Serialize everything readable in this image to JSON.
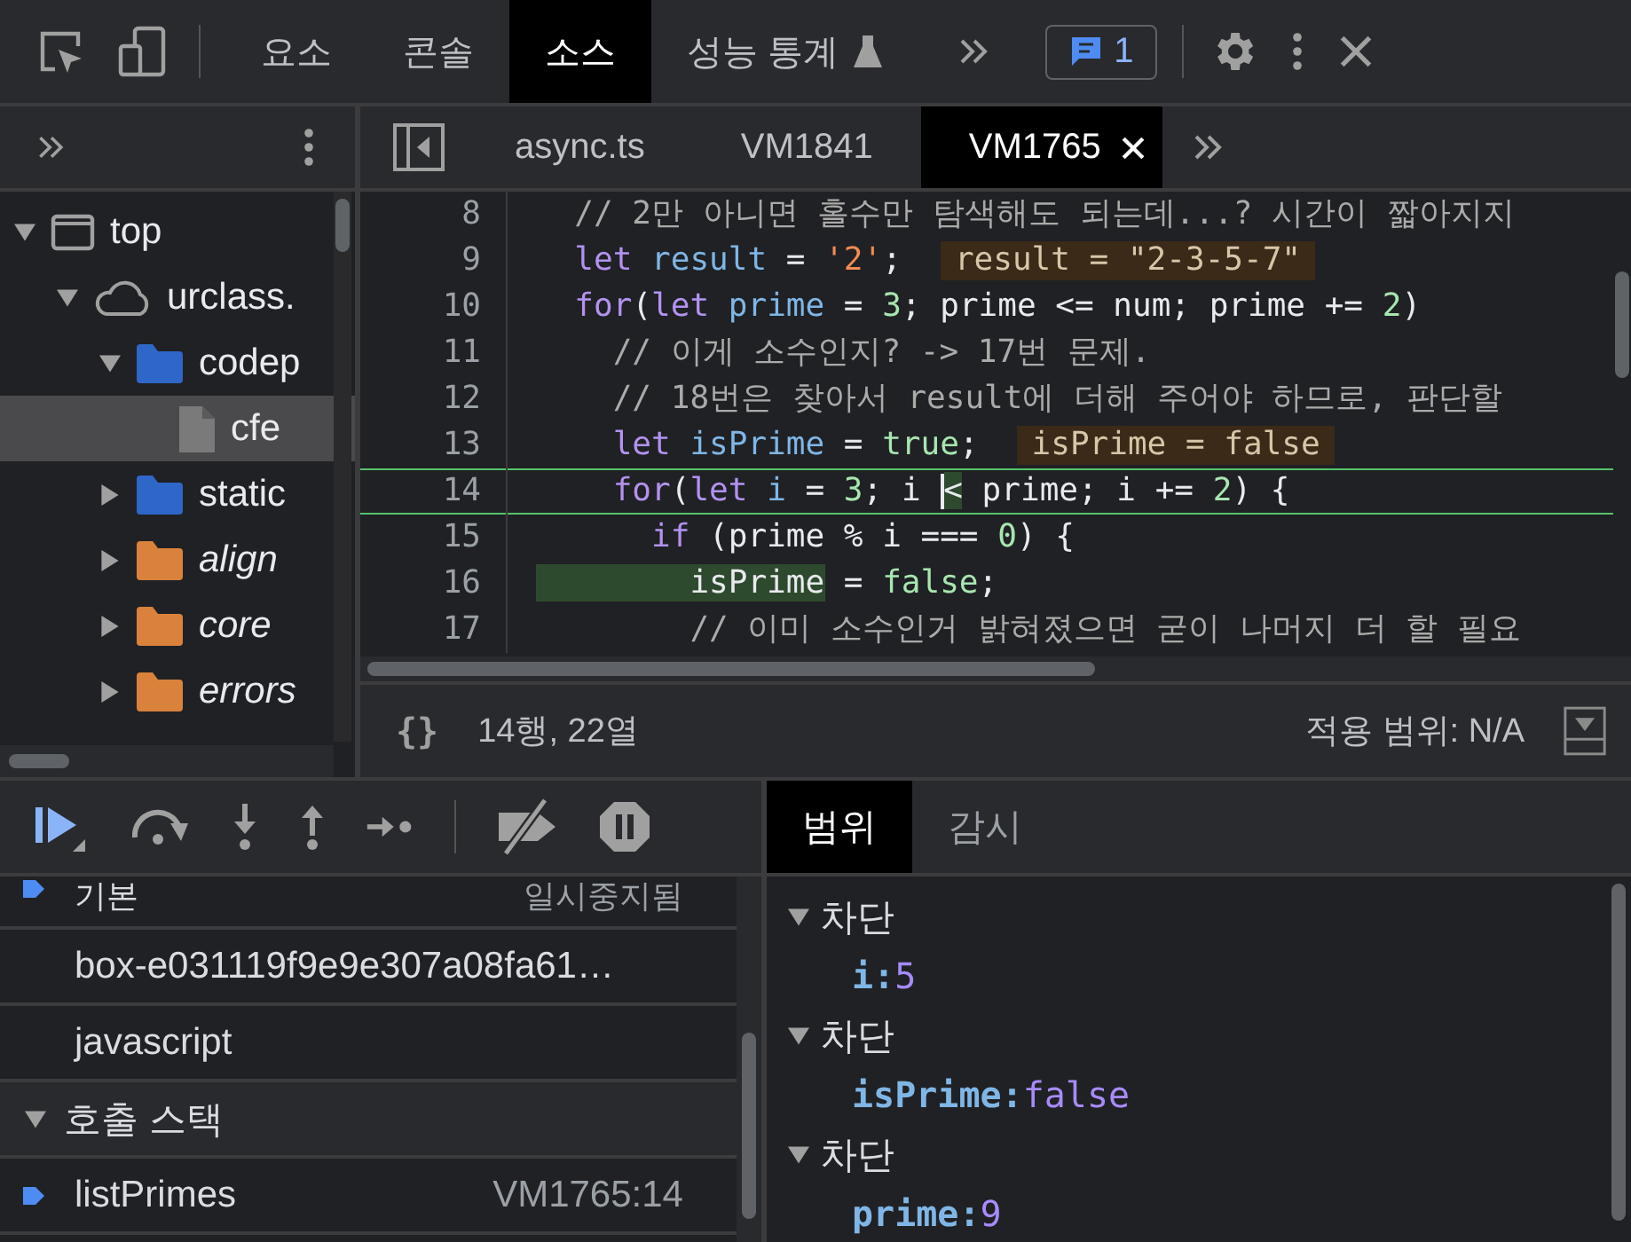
{
  "toolbar": {
    "tabs": [
      {
        "label": "요소",
        "selected": false,
        "experimental": false
      },
      {
        "label": "콘솔",
        "selected": false,
        "experimental": false
      },
      {
        "label": "소스",
        "selected": true,
        "experimental": false
      },
      {
        "label": "성능 통계",
        "selected": false,
        "experimental": true
      }
    ],
    "issues_count": "1"
  },
  "sidebar": {
    "nodes": [
      {
        "label": "top",
        "kind": "frame",
        "expanded": true,
        "selected": false,
        "children": [
          {
            "label": "urclass.",
            "kind": "domain",
            "expanded": true,
            "selected": false,
            "children": [
              {
                "label": "codep",
                "kind": "folder",
                "color": "#2f67c8",
                "ignored": false,
                "expanded": true,
                "selected": false,
                "children": [
                  {
                    "label": "cfe",
                    "kind": "file",
                    "selected": true
                  }
                ]
              },
              {
                "label": "static",
                "kind": "folder",
                "color": "#2f67c8",
                "ignored": false,
                "expanded": false,
                "selected": false
              },
              {
                "label": "align",
                "kind": "folder",
                "color": "#d9823b",
                "ignored": true,
                "expanded": false,
                "selected": false
              },
              {
                "label": "core",
                "kind": "folder",
                "color": "#d9823b",
                "ignored": true,
                "expanded": false,
                "selected": false
              },
              {
                "label": "errors",
                "kind": "folder",
                "color": "#d9823b",
                "ignored": true,
                "expanded": false,
                "selected": false
              }
            ]
          }
        ]
      }
    ]
  },
  "editor": {
    "tabs": [
      {
        "label": "async.ts",
        "selected": false,
        "closable": false
      },
      {
        "label": "VM1841",
        "selected": false,
        "closable": false
      },
      {
        "label": "VM1765",
        "selected": true,
        "closable": true
      }
    ],
    "lines": [
      {
        "number": "8",
        "current": false,
        "tokens": [
          {
            "text": "  // 2만 아니면 홀수만 탐색해도 되는데...? 시간이 짧아지지",
            "kind": "comment"
          }
        ]
      },
      {
        "number": "9",
        "current": false,
        "tokens": [
          {
            "text": "  let ",
            "kind": "keyword"
          },
          {
            "text": "result",
            "kind": "variable"
          },
          {
            "text": " = ",
            "kind": "plain"
          },
          {
            "text": "'2'",
            "kind": "string"
          },
          {
            "text": ";",
            "kind": "plain"
          }
        ],
        "inline_value": "result = \"2-3-5-7\""
      },
      {
        "number": "10",
        "current": false,
        "tokens": [
          {
            "text": "  for",
            "kind": "keyword"
          },
          {
            "text": "(",
            "kind": "plain"
          },
          {
            "text": "let ",
            "kind": "keyword"
          },
          {
            "text": "prime",
            "kind": "variable"
          },
          {
            "text": " = ",
            "kind": "plain"
          },
          {
            "text": "3",
            "kind": "number"
          },
          {
            "text": "; prime <= num; prime += ",
            "kind": "plain"
          },
          {
            "text": "2",
            "kind": "number"
          },
          {
            "text": ")",
            "kind": "plain"
          }
        ]
      },
      {
        "number": "11",
        "current": false,
        "tokens": [
          {
            "text": "    // 이게 소수인지? -> 17번 문제.",
            "kind": "comment"
          }
        ]
      },
      {
        "number": "12",
        "current": false,
        "tokens": [
          {
            "text": "    // 18번은 찾아서 result에 더해 주어야 하므로, 판단할",
            "kind": "comment"
          }
        ]
      },
      {
        "number": "13",
        "current": false,
        "tokens": [
          {
            "text": "    let ",
            "kind": "keyword"
          },
          {
            "text": "isPrime",
            "kind": "variable"
          },
          {
            "text": " = ",
            "kind": "plain"
          },
          {
            "text": "true",
            "kind": "number"
          },
          {
            "text": ";",
            "kind": "plain"
          }
        ],
        "inline_value": "isPrime = false"
      },
      {
        "number": "14",
        "current": true,
        "tokens": [
          {
            "text": "    for",
            "kind": "keyword"
          },
          {
            "text": "(",
            "kind": "plain"
          },
          {
            "text": "let ",
            "kind": "keyword"
          },
          {
            "text": "i",
            "kind": "variable"
          },
          {
            "text": " = ",
            "kind": "plain"
          },
          {
            "text": "3",
            "kind": "number"
          },
          {
            "text": "; i ",
            "kind": "plain"
          },
          {
            "text": "<",
            "kind": "plain",
            "caret": true
          },
          {
            "text": " prime; i += ",
            "kind": "plain"
          },
          {
            "text": "2",
            "kind": "number"
          },
          {
            "text": ") {",
            "kind": "plain"
          }
        ]
      },
      {
        "number": "15",
        "current": false,
        "tokens": [
          {
            "text": "      if",
            "kind": "keyword"
          },
          {
            "text": " (prime % i === ",
            "kind": "plain"
          },
          {
            "text": "0",
            "kind": "number"
          },
          {
            "text": ") {",
            "kind": "plain"
          }
        ]
      },
      {
        "number": "16",
        "current": false,
        "tokens": [
          {
            "text": "        isPrime",
            "kind": "highlight"
          },
          {
            "text": " = ",
            "kind": "plain"
          },
          {
            "text": "false",
            "kind": "number"
          },
          {
            "text": ";",
            "kind": "plain"
          }
        ]
      },
      {
        "number": "17",
        "current": false,
        "tokens": [
          {
            "text": "        // 이미 소수인거 밝혀졌으면 굳이 나머지 더 할 필요",
            "kind": "comment"
          }
        ]
      }
    ],
    "status": {
      "format": "{}",
      "position": "14행, 22열",
      "coverage": "적용 범위: N/A"
    }
  },
  "threads": [
    {
      "name": "기본",
      "status": "일시중지됨",
      "current": true
    },
    {
      "name": "box-e031119f9e9e307a08fa61…",
      "current": false
    },
    {
      "name": "javascript",
      "current": false
    }
  ],
  "call_stack": {
    "title": "호출 스택",
    "expanded": true,
    "frames": [
      {
        "name": "listPrimes",
        "location": "VM1765:14",
        "current": true
      }
    ]
  },
  "scope": {
    "tabs": [
      {
        "label": "범위",
        "selected": true
      },
      {
        "label": "감시",
        "selected": false
      }
    ],
    "blocks": [
      {
        "title": "차단",
        "expanded": true,
        "vars": [
          {
            "name": "i:",
            "value": "5"
          }
        ]
      },
      {
        "title": "차단",
        "expanded": true,
        "vars": [
          {
            "name": "isPrime:",
            "value": "false"
          }
        ]
      },
      {
        "title": "차단",
        "expanded": true,
        "vars": [
          {
            "name": "prime:",
            "value": "9"
          }
        ]
      }
    ]
  }
}
